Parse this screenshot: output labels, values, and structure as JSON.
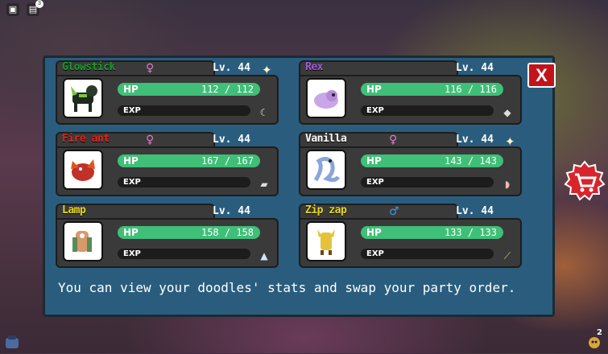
{
  "party": [
    {
      "name": "Glowstick",
      "name_color": "#1a9a2a",
      "gender": "♀",
      "gender_color": "#e07ac8",
      "level": "Lv. 44",
      "hp_label": "HP",
      "hp": "112 / 112",
      "exp_label": "EXP",
      "item_icon": "moon-icon",
      "sparkle": true,
      "portrait_icon": "green-black-doodle"
    },
    {
      "name": "Rex",
      "name_color": "#a35bd9",
      "gender": "",
      "gender_color": "#ffffff",
      "level": "Lv. 44",
      "hp_label": "HP",
      "hp": "116 / 116",
      "exp_label": "EXP",
      "item_icon": "bag-icon",
      "sparkle": false,
      "portrait_icon": "purple-doodle"
    },
    {
      "name": "Fire ant",
      "name_color": "#e0241a",
      "gender": "♀",
      "gender_color": "#e07ac8",
      "level": "Lv. 44",
      "hp_label": "HP",
      "hp": "167 / 167",
      "exp_label": "EXP",
      "item_icon": "bread-icon",
      "sparkle": false,
      "portrait_icon": "red-dragon-doodle"
    },
    {
      "name": "Vanilla",
      "name_color": "#ffffff",
      "gender": "♀",
      "gender_color": "#e07ac8",
      "level": "Lv. 44",
      "hp_label": "HP",
      "hp": "143 / 143",
      "exp_label": "EXP",
      "item_icon": "shell-icon",
      "sparkle": true,
      "portrait_icon": "white-snake-doodle"
    },
    {
      "name": "Lamp",
      "name_color": "#e6d81c",
      "gender": "",
      "gender_color": "#ffffff",
      "level": "Lv. 44",
      "hp_label": "HP",
      "hp": "158 / 158",
      "exp_label": "EXP",
      "item_icon": "crystal-icon",
      "sparkle": false,
      "portrait_icon": "lamp-doodle"
    },
    {
      "name": "Zip zap",
      "name_color": "#e6d81c",
      "gender": "♂",
      "gender_color": "#3a9be0",
      "level": "Lv. 44",
      "hp_label": "HP",
      "hp": "133 / 133",
      "exp_label": "EXP",
      "item_icon": "brush-icon",
      "sparkle": false,
      "portrait_icon": "yellow-doodle"
    }
  ],
  "description": "You can view your doodles' stats and swap your party order.",
  "close_label": "X",
  "topbar": {
    "chat_badge": "3"
  },
  "bottom_right_badge": "2",
  "colors": {
    "panel": "#2a5d7d",
    "card": "#3a3a3a",
    "hp": "#3fbf77",
    "close": "#c4121b"
  }
}
